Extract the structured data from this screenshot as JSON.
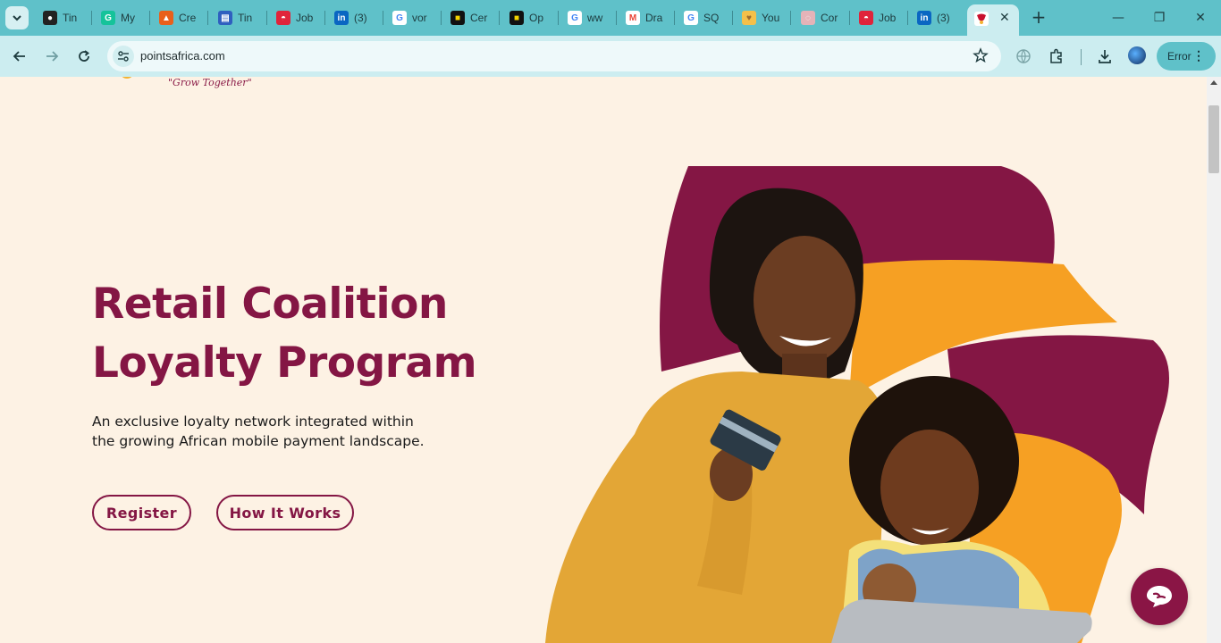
{
  "browser": {
    "tabs": [
      {
        "label": "Tin",
        "icon": "github-icon"
      },
      {
        "label": "My",
        "icon": "grammarly-icon"
      },
      {
        "label": "Cre",
        "icon": "flame-icon"
      },
      {
        "label": "Tin",
        "icon": "document-icon"
      },
      {
        "label": "Job",
        "icon": "job-board-icon"
      },
      {
        "label": "(3)",
        "icon": "linkedin-icon"
      },
      {
        "label": "vor",
        "icon": "google-icon"
      },
      {
        "label": "Cer",
        "icon": "black-square-icon"
      },
      {
        "label": "Op",
        "icon": "black-square-icon"
      },
      {
        "label": "ww",
        "icon": "google-icon"
      },
      {
        "label": "Dra",
        "icon": "gmail-icon"
      },
      {
        "label": "SQ",
        "icon": "google-icon"
      },
      {
        "label": "You",
        "icon": "app-icon"
      },
      {
        "label": "Cor",
        "icon": "loading-icon"
      },
      {
        "label": "Job",
        "icon": "job-board-icon"
      },
      {
        "label": "(3)",
        "icon": "linkedin-icon"
      }
    ],
    "active_tab": {
      "icon": "pointsafrica-favicon"
    },
    "url": "pointsafrica.com",
    "profile_chip": "Error"
  },
  "page": {
    "tagline": "\"Grow Together\"",
    "hero": {
      "title_line1": "Retail Coalition",
      "title_line2": "Loyalty Program",
      "desc_line1": "An exclusive loyalty network integrated within",
      "desc_line2": "the growing African mobile payment landscape."
    },
    "buttons": {
      "register": "Register",
      "how_it_works": "How It Works"
    }
  },
  "colors": {
    "brand_maroon": "#841644",
    "brand_orange": "#f6a023",
    "background": "#fdf2e4",
    "chrome_teal": "#5fc1c9"
  }
}
